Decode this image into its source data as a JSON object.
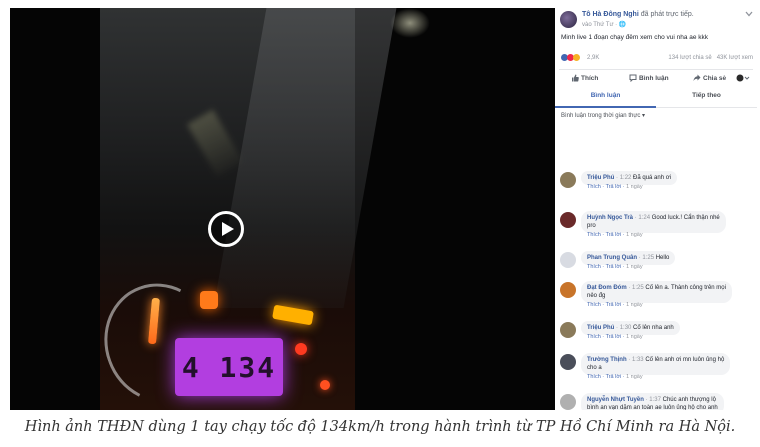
{
  "video": {
    "speedometer_reading": "4 134"
  },
  "post": {
    "author": "Tô Hà Đông Nghi",
    "action": "đã phát trực tiếp.",
    "time": "vào Thứ Tư · 🌐",
    "text": "Minh live 1 đoạn chạy đêm xem cho vui nha ae kkk",
    "reaction_count": "2,9K",
    "stats": "134 lượt chia sẻ   43K lượt xem",
    "reaction_colors": [
      "#4267b2",
      "#f0284a",
      "#f7b125"
    ]
  },
  "actions": {
    "like": "Thích",
    "comment": "Bình luận",
    "share": "Chia sẻ"
  },
  "tabs": {
    "comments": "Bình luận",
    "follow": "Tiếp theo"
  },
  "sort_label": "Bình luận trong thời gian thực ▾",
  "comment_links": {
    "like": "Thích",
    "reply": "Trả lời",
    "time": "1 ngày"
  },
  "comments": [
    {
      "name": "Triệu Phú",
      "time": "1:22",
      "text": "Đã quá anh ơi",
      "color": "#8a7a5a"
    },
    {
      "name": "Huỳnh Ngọc Trà",
      "time": "1:24",
      "text": "Good luck.! Cẩn thận nhé",
      "text2": "pro",
      "color": "#6a2a2a"
    },
    {
      "name": "Phan Trung Quân",
      "time": "1:25",
      "text": "Hello",
      "color": "#d8dbe2"
    },
    {
      "name": "Đạt Đom Đóm",
      "time": "1:25",
      "text": "Cố lên a. Thành công trên mọi",
      "text2": "nẻo đg",
      "color": "#c8742a"
    },
    {
      "name": "Triệu Phú",
      "time": "1:30",
      "text": "Cố lên nha anh",
      "color": "#8a7a5a"
    },
    {
      "name": "Trường Thịnh",
      "time": "1:33",
      "text": "Cố lên anh ơi mn luôn ủng hộ",
      "text2": "cho a",
      "color": "#4a4e5a"
    },
    {
      "name": "Nguyễn Nhựt Tuyền",
      "time": "1:37",
      "text": "Chúc anh thượng lộ",
      "text2": "bình an vạn dặm an toàn ae luôn ủng hộ cho anh",
      "color": "#b0b0b0"
    }
  ],
  "caption": "Hình ảnh THĐN dùng 1 tay chạy tốc độ 134km/h trong hành trình từ TP Hồ Chí Minh ra Hà Nội."
}
